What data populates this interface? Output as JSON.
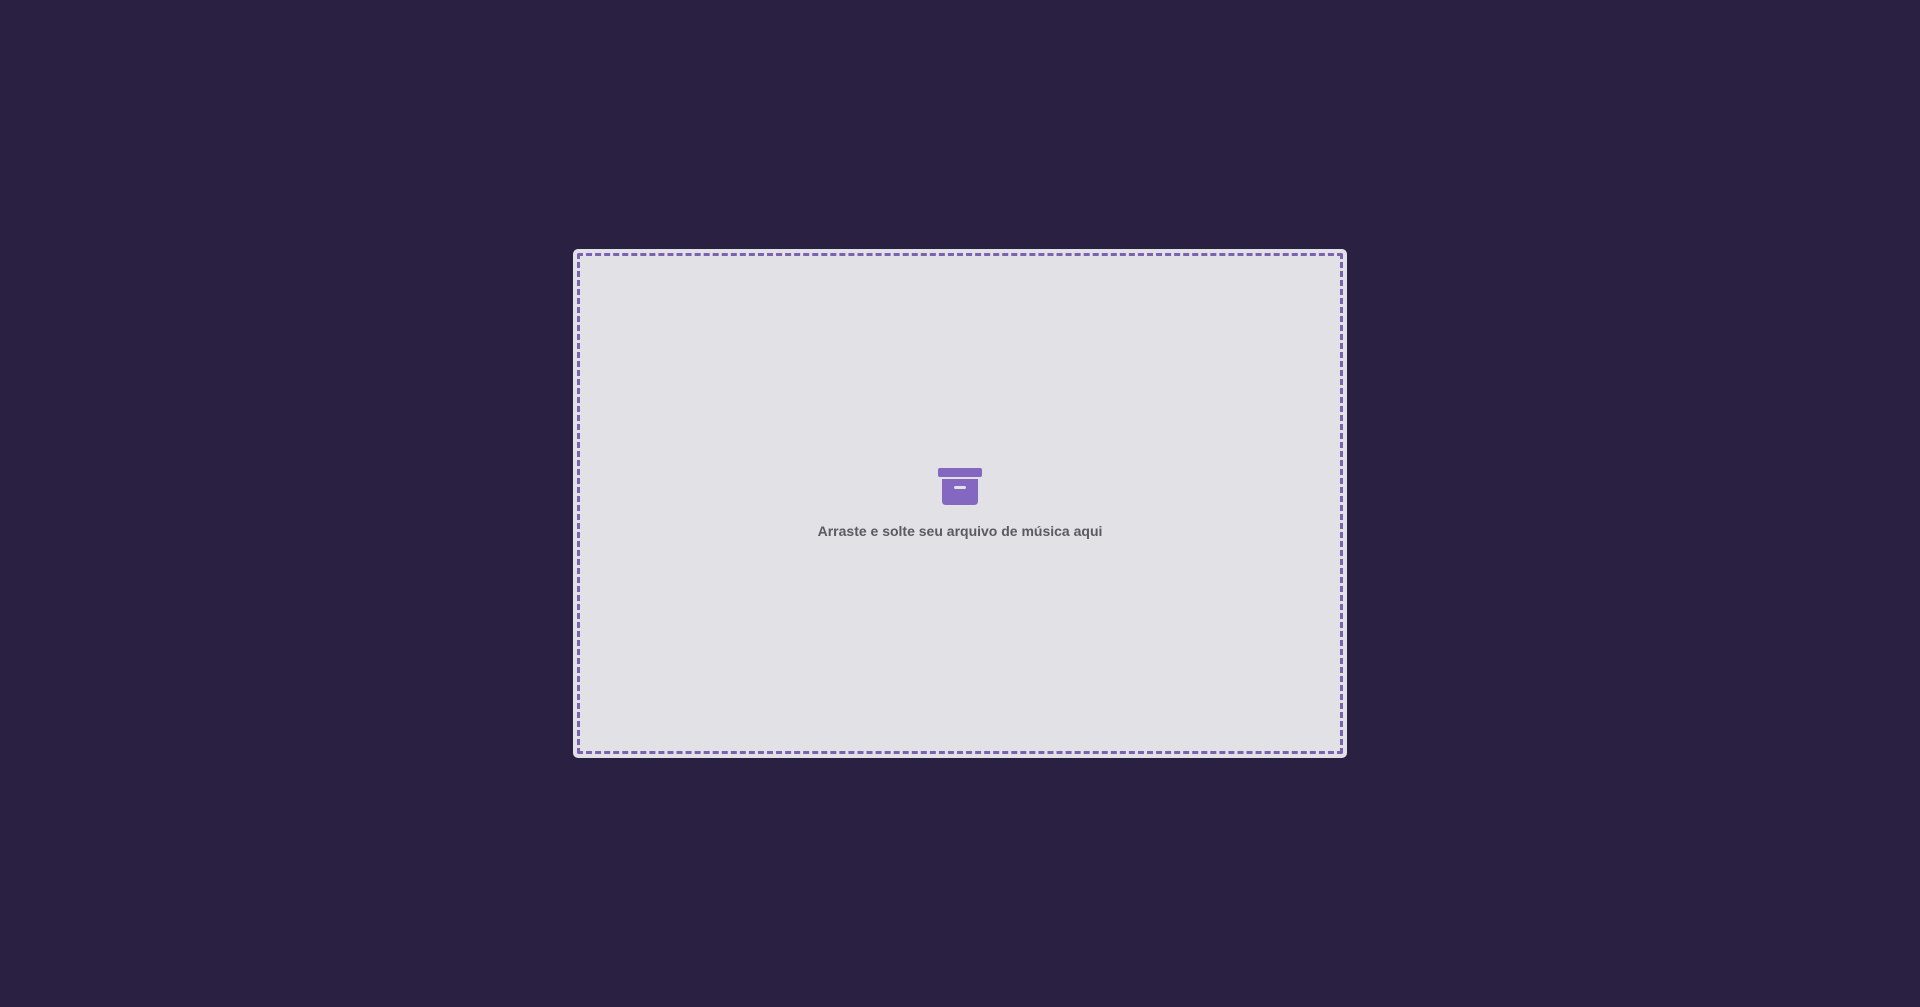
{
  "dropzone": {
    "label": "Arraste e solte seu arquivo de música aqui",
    "icon": "archive-box-icon"
  },
  "colors": {
    "background": "#2a2142",
    "card": "#e2e1e6",
    "accent": "#8467c0",
    "text": "#5a5a62"
  }
}
